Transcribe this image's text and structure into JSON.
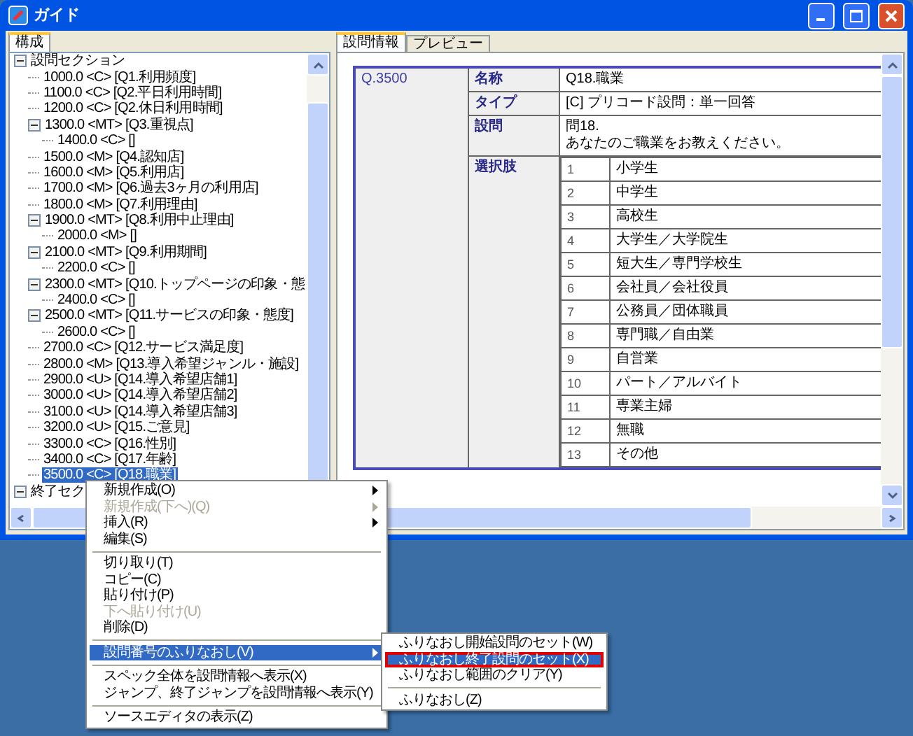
{
  "window": {
    "title": "ガイド"
  },
  "left_tabs": [
    {
      "label": "構成",
      "selected": true
    }
  ],
  "tree": [
    {
      "label": "設問セクション",
      "expanded": true,
      "selected": false,
      "children": [
        {
          "label": "1000.0 <C> [Q1.利用頻度]",
          "selected": false
        },
        {
          "label": "1100.0 <C> [Q2.平日利用時間]",
          "selected": false
        },
        {
          "label": "1200.0 <C> [Q2.休日利用時間]",
          "selected": false
        },
        {
          "label": "1300.0 <MT> [Q3.重視点]",
          "expanded": true,
          "selected": false,
          "children": [
            {
              "label": "1400.0 <C> []",
              "selected": false
            }
          ]
        },
        {
          "label": "1500.0 <M> [Q4.認知店]",
          "selected": false
        },
        {
          "label": "1600.0 <M> [Q5.利用店]",
          "selected": false
        },
        {
          "label": "1700.0 <M> [Q6.過去3ヶ月の利用店]",
          "selected": false
        },
        {
          "label": "1800.0 <M> [Q7.利用理由]",
          "selected": false
        },
        {
          "label": "1900.0 <MT> [Q8.利用中止理由]",
          "expanded": true,
          "selected": false,
          "children": [
            {
              "label": "2000.0 <M> []",
              "selected": false
            }
          ]
        },
        {
          "label": "2100.0 <MT> [Q9.利用期間]",
          "expanded": true,
          "selected": false,
          "children": [
            {
              "label": "2200.0 <C> []",
              "selected": false
            }
          ]
        },
        {
          "label": "2300.0 <MT> [Q10.トップページの印象・態",
          "expanded": true,
          "selected": false,
          "children": [
            {
              "label": "2400.0 <C> []",
              "selected": false
            }
          ]
        },
        {
          "label": "2500.0 <MT> [Q11.サービスの印象・態度]",
          "expanded": true,
          "selected": false,
          "children": [
            {
              "label": "2600.0 <C> []",
              "selected": false
            }
          ]
        },
        {
          "label": "2700.0 <C> [Q12.サービス満足度]",
          "selected": false
        },
        {
          "label": "2800.0 <M> [Q13.導入希望ジャンル・施設]",
          "selected": false
        },
        {
          "label": "2900.0 <U> [Q14.導入希望店舗1]",
          "selected": false
        },
        {
          "label": "3000.0 <U> [Q14.導入希望店舗2]",
          "selected": false
        },
        {
          "label": "3100.0 <U> [Q14.導入希望店舗3]",
          "selected": false
        },
        {
          "label": "3200.0 <U> [Q15.ご意見]",
          "selected": false
        },
        {
          "label": "3300.0 <C> [Q16.性別]",
          "selected": false
        },
        {
          "label": "3400.0 <C> [Q17.年齢]",
          "selected": false
        },
        {
          "label": "3500.0 <C> [Q18.職業]",
          "selected": true
        }
      ]
    },
    {
      "label": "終了セク",
      "expanded": true,
      "selected": false
    }
  ],
  "right_tabs": [
    {
      "label": "設問情報",
      "selected": true
    },
    {
      "label": "プレビュー",
      "selected": false
    }
  ],
  "question": {
    "id": "Q.3500",
    "fields": [
      {
        "label": "名称",
        "value": "Q18.職業"
      },
      {
        "label": "タイプ",
        "value": "[C] プリコード設問：単一回答"
      },
      {
        "label": "設問",
        "value": "問18.",
        "value_2": "あなたのご職業をお教えください。"
      }
    ],
    "choices_label": "選択肢",
    "choices": [
      {
        "no": "1",
        "text": "小学生"
      },
      {
        "no": "2",
        "text": "中学生"
      },
      {
        "no": "3",
        "text": "高校生"
      },
      {
        "no": "4",
        "text": "大学生／大学院生"
      },
      {
        "no": "5",
        "text": "短大生／専門学校生"
      },
      {
        "no": "6",
        "text": "会社員／会社役員"
      },
      {
        "no": "7",
        "text": "公務員／団体職員"
      },
      {
        "no": "8",
        "text": "専門職／自由業"
      },
      {
        "no": "9",
        "text": "自営業"
      },
      {
        "no": "10",
        "text": "パート／アルバイト"
      },
      {
        "no": "11",
        "text": "専業主婦"
      },
      {
        "no": "12",
        "text": "無職"
      },
      {
        "no": "13",
        "text": "その他"
      }
    ]
  },
  "context_menu": [
    {
      "kind": "item",
      "label": "新規作成(O)",
      "disabled": false,
      "submenu": true,
      "selected": false
    },
    {
      "kind": "item",
      "label": "新規作成(下へ)(Q)",
      "disabled": true,
      "submenu": true,
      "selected": false
    },
    {
      "kind": "item",
      "label": "挿入(R)",
      "disabled": false,
      "submenu": true,
      "selected": false
    },
    {
      "kind": "item",
      "label": "編集(S)",
      "disabled": false,
      "submenu": false,
      "selected": false
    },
    {
      "kind": "separator"
    },
    {
      "kind": "item",
      "label": "切り取り(T)",
      "disabled": false,
      "submenu": false,
      "selected": false
    },
    {
      "kind": "item",
      "label": "コピー(C)",
      "disabled": false,
      "submenu": false,
      "selected": false
    },
    {
      "kind": "item",
      "label": "貼り付け(P)",
      "disabled": false,
      "submenu": false,
      "selected": false
    },
    {
      "kind": "item",
      "label": "下へ貼り付け(U)",
      "disabled": true,
      "submenu": false,
      "selected": false
    },
    {
      "kind": "item",
      "label": "削除(D)",
      "disabled": false,
      "submenu": false,
      "selected": false
    },
    {
      "kind": "separator"
    },
    {
      "kind": "item",
      "label": "設問番号のふりなおし(V)",
      "disabled": false,
      "submenu": true,
      "selected": true
    },
    {
      "kind": "separator"
    },
    {
      "kind": "item",
      "label": "スペック全体を設問情報へ表示(X)",
      "disabled": false,
      "submenu": false,
      "selected": false
    },
    {
      "kind": "item",
      "label": "ジャンプ、終了ジャンプを設問情報へ表示(Y)",
      "disabled": false,
      "submenu": false,
      "selected": false
    },
    {
      "kind": "separator"
    },
    {
      "kind": "item",
      "label": "ソースエディタの表示(Z)",
      "disabled": false,
      "submenu": false,
      "selected": false
    }
  ],
  "submenu": [
    {
      "kind": "item",
      "label": "ふりなおし開始設問のセット(W)",
      "selected": false,
      "outlined": false
    },
    {
      "kind": "item",
      "label": "ふりなおし終了設問のセット(X)",
      "selected": true,
      "outlined": true
    },
    {
      "kind": "item",
      "label": "ふりなおし範囲のクリア(Y)",
      "selected": false,
      "outlined": false
    },
    {
      "kind": "separator"
    },
    {
      "kind": "item",
      "label": "ふりなおし(Z)",
      "selected": false,
      "outlined": false
    }
  ]
}
